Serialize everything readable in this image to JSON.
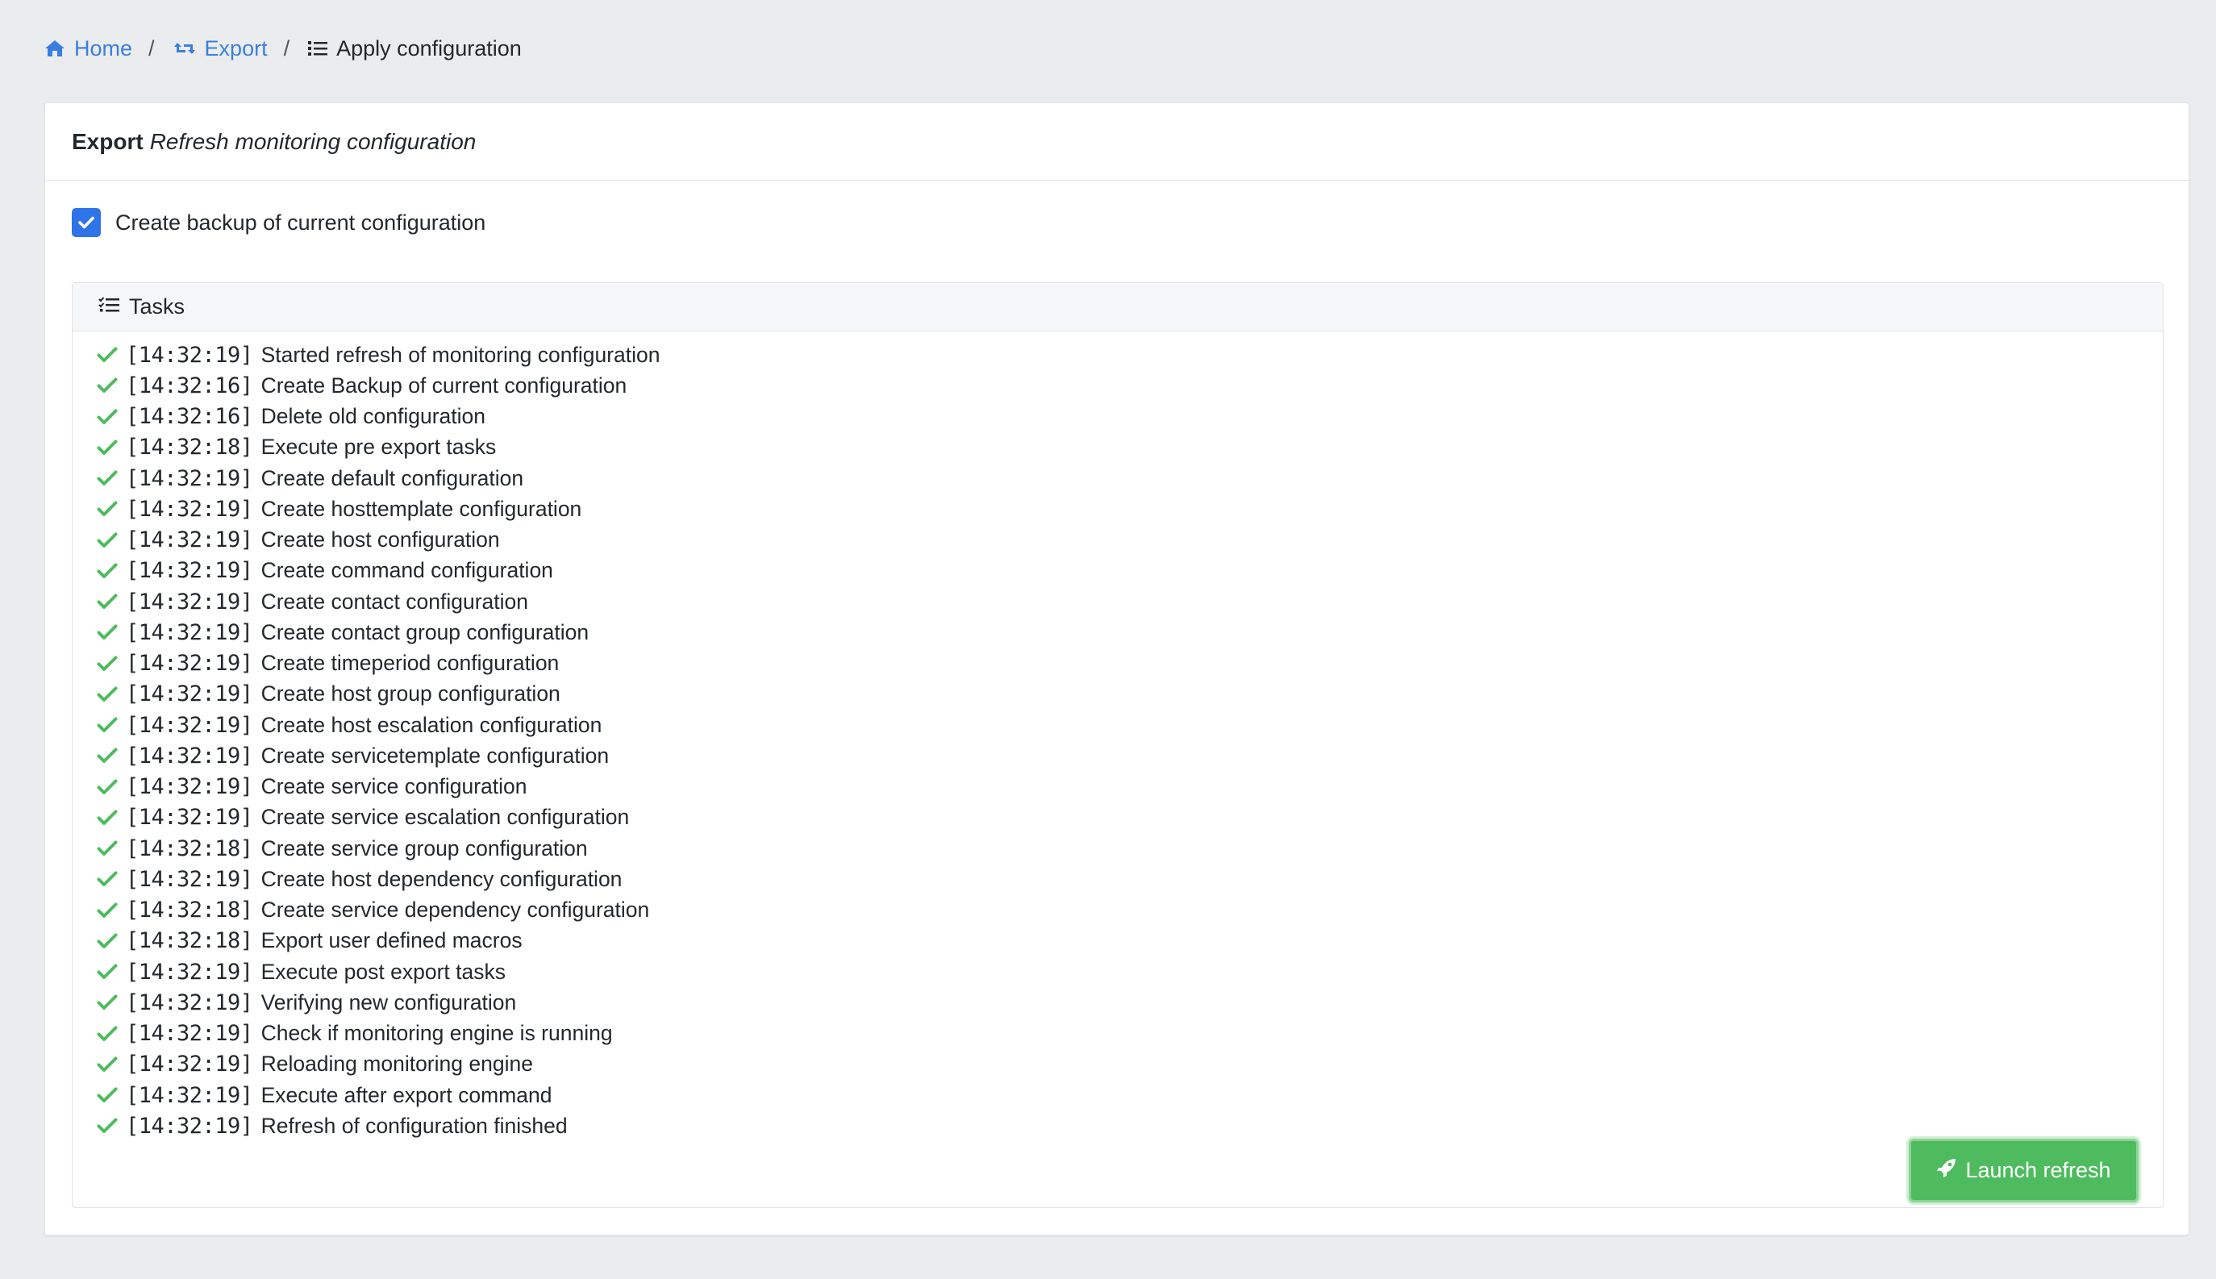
{
  "breadcrumb": {
    "home": "Home",
    "export": "Export",
    "current": "Apply configuration",
    "separator": "/"
  },
  "card": {
    "title": "Export",
    "subtitle": "Refresh monitoring configuration"
  },
  "backup": {
    "label": "Create backup of current configuration",
    "checked": true
  },
  "tasks": {
    "header": "Tasks",
    "items": [
      {
        "time": "[14:32:19]",
        "text": "Started refresh of monitoring configuration"
      },
      {
        "time": "[14:32:16]",
        "text": "Create Backup of current configuration"
      },
      {
        "time": "[14:32:16]",
        "text": "Delete old configuration"
      },
      {
        "time": "[14:32:18]",
        "text": "Execute pre export tasks"
      },
      {
        "time": "[14:32:19]",
        "text": "Create default configuration"
      },
      {
        "time": "[14:32:19]",
        "text": "Create hosttemplate configuration"
      },
      {
        "time": "[14:32:19]",
        "text": "Create host configuration"
      },
      {
        "time": "[14:32:19]",
        "text": "Create command configuration"
      },
      {
        "time": "[14:32:19]",
        "text": "Create contact configuration"
      },
      {
        "time": "[14:32:19]",
        "text": "Create contact group configuration"
      },
      {
        "time": "[14:32:19]",
        "text": "Create timeperiod configuration"
      },
      {
        "time": "[14:32:19]",
        "text": "Create host group configuration"
      },
      {
        "time": "[14:32:19]",
        "text": "Create host escalation configuration"
      },
      {
        "time": "[14:32:19]",
        "text": "Create servicetemplate configuration"
      },
      {
        "time": "[14:32:19]",
        "text": "Create service configuration"
      },
      {
        "time": "[14:32:19]",
        "text": "Create service escalation configuration"
      },
      {
        "time": "[14:32:18]",
        "text": "Create service group configuration"
      },
      {
        "time": "[14:32:19]",
        "text": "Create host dependency configuration"
      },
      {
        "time": "[14:32:18]",
        "text": "Create service dependency configuration"
      },
      {
        "time": "[14:32:18]",
        "text": "Export user defined macros"
      },
      {
        "time": "[14:32:19]",
        "text": "Execute post export tasks"
      },
      {
        "time": "[14:32:19]",
        "text": "Verifying new configuration"
      },
      {
        "time": "[14:32:19]",
        "text": "Check if monitoring engine is running"
      },
      {
        "time": "[14:32:19]",
        "text": "Reloading monitoring engine"
      },
      {
        "time": "[14:32:19]",
        "text": "Execute after export command"
      },
      {
        "time": "[14:32:19]",
        "text": "Refresh of configuration finished"
      }
    ]
  },
  "launch_button": {
    "label": "Launch refresh",
    "icon": "rocket-icon"
  },
  "colors": {
    "link": "#3a7fe0",
    "success": "#4dbb5e",
    "checkbox": "#2f73e8"
  }
}
